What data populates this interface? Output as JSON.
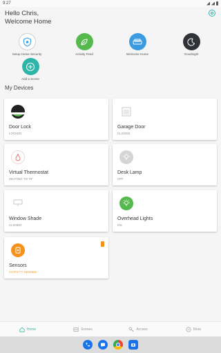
{
  "status_bar": {
    "time": "9:27"
  },
  "header": {
    "greeting_line1": "Hello Chris,",
    "greeting_line2": "Welcome Home"
  },
  "scenes": [
    {
      "label": "Setup Home Security",
      "icon": "shield-icon",
      "color": "#ffffff"
    },
    {
      "label": "Activity Feed",
      "icon": "leaf-icon",
      "color": "#55b94e"
    },
    {
      "label": "Welcome Home",
      "icon": "sofa-icon",
      "color": "#3a9be0"
    },
    {
      "label": "Goodnight",
      "icon": "moon-icon",
      "color": "#2f3236"
    },
    {
      "label": "Add a Scene",
      "icon": "plus-icon",
      "color": "#2eb5a8"
    }
  ],
  "devices_title": "My Devices",
  "devices": [
    {
      "name": "Door Lock",
      "status": "LOCKED",
      "icon": "lock-icon"
    },
    {
      "name": "Garage Door",
      "status": "CLOSED",
      "icon": "garage-icon"
    },
    {
      "name": "Virtual Thermostat",
      "status": "HEATING TO 70°",
      "icon": "thermostat-icon"
    },
    {
      "name": "Desk Lamp",
      "status": "OFF",
      "icon": "lamp-icon"
    },
    {
      "name": "Window Shade",
      "status": "CLOSED",
      "icon": "shade-icon"
    },
    {
      "name": "Overhead Lights",
      "status": "ON",
      "icon": "light-icon"
    },
    {
      "name": "Sensors",
      "status": "ACTIVITY SENSED",
      "icon": "sensor-icon"
    }
  ],
  "nav": [
    {
      "label": "Home",
      "icon": "home-icon"
    },
    {
      "label": "Scenes",
      "icon": "scenes-icon"
    },
    {
      "label": "Access",
      "icon": "key-icon"
    },
    {
      "label": "More",
      "icon": "more-icon"
    }
  ],
  "colors": {
    "accent": "#2eb5a8",
    "warning": "#f5921e",
    "green": "#55b94e",
    "blue": "#3a9be0"
  }
}
